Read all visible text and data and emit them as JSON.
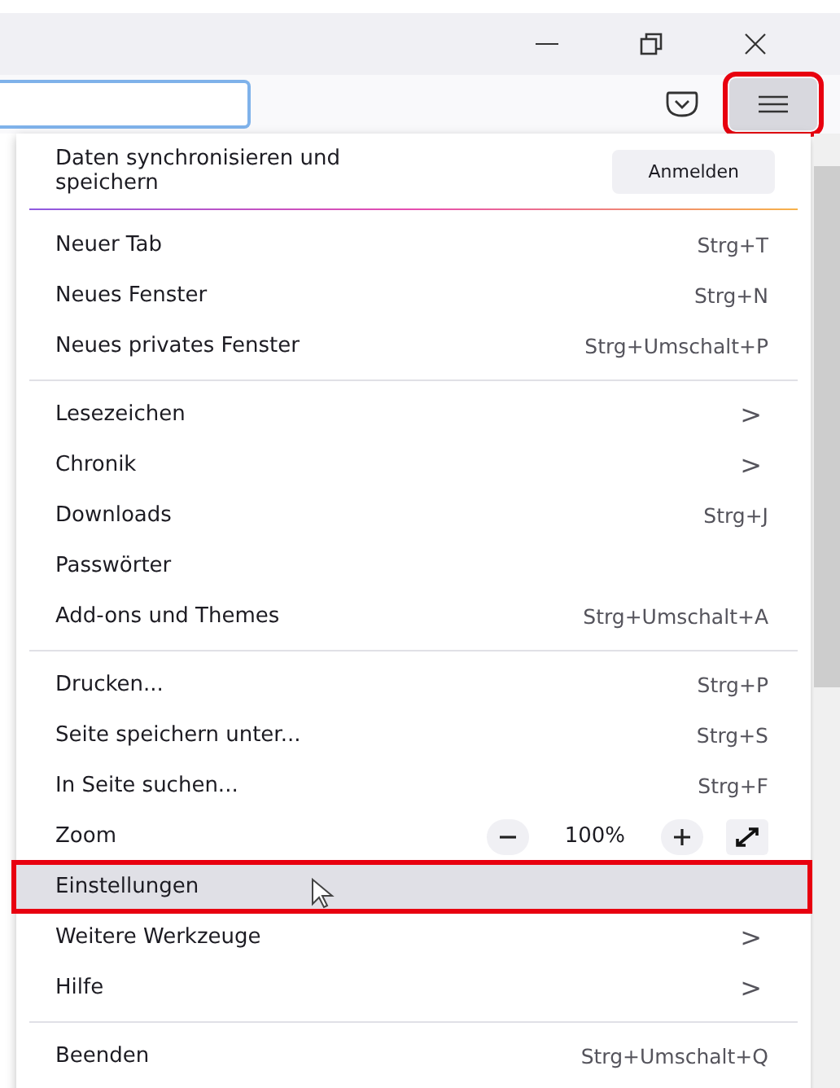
{
  "toolbar": {
    "menu_button": {
      "highlighted": true
    }
  },
  "menu": {
    "sync": {
      "text": "Daten synchronisieren und speichern",
      "button": "Anmelden"
    },
    "items": [
      {
        "kind": "item",
        "label": "Neuer Tab",
        "shortcut": "Strg+T",
        "selected": false,
        "highlighted": false
      },
      {
        "kind": "item",
        "label": "Neues Fenster",
        "shortcut": "Strg+N",
        "selected": false,
        "highlighted": false
      },
      {
        "kind": "item",
        "label": "Neues privates Fenster",
        "shortcut": "Strg+Umschalt+P",
        "selected": false,
        "highlighted": false
      },
      {
        "kind": "separator"
      },
      {
        "kind": "submenu",
        "label": "Lesezeichen",
        "arrow": ">",
        "selected": false,
        "highlighted": false
      },
      {
        "kind": "submenu",
        "label": "Chronik",
        "arrow": ">",
        "selected": false,
        "highlighted": false
      },
      {
        "kind": "item",
        "label": "Downloads",
        "shortcut": "Strg+J",
        "selected": false,
        "highlighted": false
      },
      {
        "kind": "item",
        "label": "Passwörter",
        "selected": false,
        "highlighted": false
      },
      {
        "kind": "item",
        "label": "Add-ons und Themes",
        "shortcut": "Strg+Umschalt+A",
        "selected": false,
        "highlighted": false
      },
      {
        "kind": "separator"
      },
      {
        "kind": "item",
        "label": "Drucken...",
        "shortcut": "Strg+P",
        "selected": false,
        "highlighted": false
      },
      {
        "kind": "item",
        "label": "Seite speichern unter...",
        "shortcut": "Strg+S",
        "selected": false,
        "highlighted": false
      },
      {
        "kind": "item",
        "label": "In Seite suchen...",
        "shortcut": "Strg+F",
        "selected": false,
        "highlighted": false
      },
      {
        "kind": "zoom",
        "label": "Zoom",
        "value": "100%"
      },
      {
        "kind": "item",
        "label": "Einstellungen",
        "selected": true,
        "highlighted": true,
        "cursor": true
      },
      {
        "kind": "submenu",
        "label": "Weitere Werkzeuge",
        "arrow": ">",
        "selected": false,
        "highlighted": false
      },
      {
        "kind": "submenu",
        "label": "Hilfe",
        "arrow": ">",
        "selected": false,
        "highlighted": false
      },
      {
        "kind": "separator"
      },
      {
        "kind": "item",
        "label": "Beenden",
        "shortcut": "Strg+Umschalt+Q",
        "selected": false,
        "highlighted": false
      }
    ]
  }
}
